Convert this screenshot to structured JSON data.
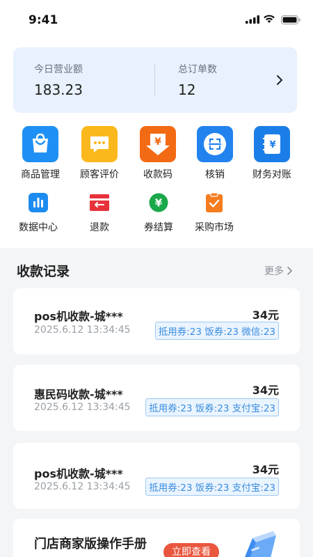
{
  "status_bar": {
    "time": "9:41"
  },
  "stats": {
    "revenue_label": "今日营业额",
    "revenue_value": "183.23",
    "orders_label": "总订单数",
    "orders_value": "12"
  },
  "features": [
    {
      "label": "商品管理",
      "icon": "shopping-bag-icon",
      "color": "#1e90f5"
    },
    {
      "label": "顾客评价",
      "icon": "chat-bubble-icon",
      "color": "#fbb81c"
    },
    {
      "label": "收款码",
      "icon": "yen-download-icon",
      "color": "#f36a14"
    },
    {
      "label": "核销",
      "icon": "scan-icon",
      "color": "#2383ee"
    },
    {
      "label": "财务对账",
      "icon": "yen-notebook-icon",
      "color": "#1b7ee8"
    },
    {
      "label": "数据中心",
      "icon": "bar-chart-icon",
      "color": "#1d8cf0"
    },
    {
      "label": "退款",
      "icon": "refund-icon",
      "color": "#e8323b"
    },
    {
      "label": "券结算",
      "icon": "yen-coin-icon",
      "color": "#1aa84a"
    },
    {
      "label": "采购市场",
      "icon": "clipboard-check-icon",
      "color": "#f57c1f"
    }
  ],
  "records": {
    "title": "收款记录",
    "more": "更多",
    "items": [
      {
        "title": "pos机收款-城***",
        "date": "2025.6.12 13:34:45",
        "amount": "34元",
        "tags": "抵用券:23 饭券:23 微信:23"
      },
      {
        "title": "惠民码收款-城***",
        "date": "2025.6.12 13:34:45",
        "amount": "34元",
        "tags": "抵用券:23 饭券:23 支付宝:23"
      },
      {
        "title": "pos机收款-城***",
        "date": "2025.6.12 13:34:45",
        "amount": "34元",
        "tags": "抵用券:23 饭券:23 支付宝:23"
      }
    ]
  },
  "manual": {
    "title": "门店商家版操作手册",
    "button": "立即查看"
  }
}
